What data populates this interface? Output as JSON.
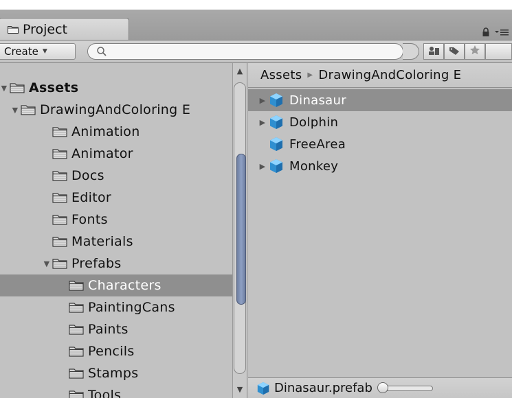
{
  "window": {
    "tab_label": "Project"
  },
  "toolbar": {
    "create_label": "Create",
    "search_placeholder": ""
  },
  "colors": {
    "selection": "#8f8f8f",
    "scroll_thumb": "#7e90b4",
    "folder": "#d8d8d8",
    "prefab_cube": "#3aa0e0"
  },
  "tree": {
    "items": [
      {
        "label": "Assets",
        "depth": 0,
        "expanded": true,
        "bold": true
      },
      {
        "label": "DrawingAndColoring E",
        "depth": 1,
        "expanded": true
      },
      {
        "label": "Animation",
        "depth": 2
      },
      {
        "label": "Animator",
        "depth": 2
      },
      {
        "label": "Docs",
        "depth": 2
      },
      {
        "label": "Editor",
        "depth": 2
      },
      {
        "label": "Fonts",
        "depth": 2
      },
      {
        "label": "Materials",
        "depth": 2
      },
      {
        "label": "Prefabs",
        "depth": 2,
        "expanded": true
      },
      {
        "label": "Characters",
        "depth": 3,
        "selected": true
      },
      {
        "label": "PaintingCans",
        "depth": 3
      },
      {
        "label": "Paints",
        "depth": 3
      },
      {
        "label": "Pencils",
        "depth": 3
      },
      {
        "label": "Stamps",
        "depth": 3
      },
      {
        "label": "Tools",
        "depth": 3
      }
    ]
  },
  "breadcrumb": {
    "root": "Assets",
    "current": "DrawingAndColoring E"
  },
  "assets": {
    "items": [
      {
        "label": "Dinasaur",
        "has_children": true,
        "selected": true
      },
      {
        "label": "Dolphin",
        "has_children": true
      },
      {
        "label": "FreeArea",
        "has_children": false
      },
      {
        "label": "Monkey",
        "has_children": true
      }
    ]
  },
  "status": {
    "selected_file": "Dinasaur.prefab",
    "zoom": 0
  }
}
